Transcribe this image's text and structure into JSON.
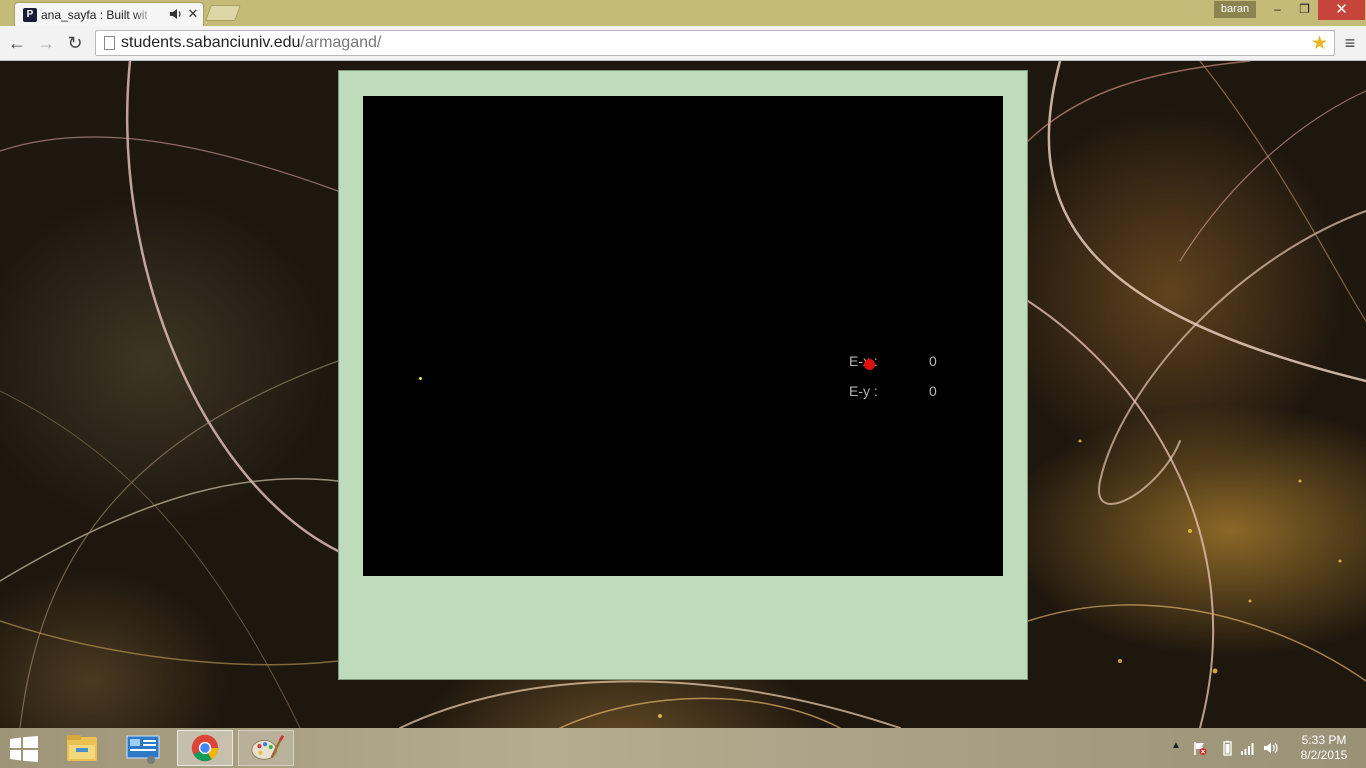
{
  "browser": {
    "tab": {
      "title": "ana_sayfa : Built with P",
      "favicon_letter": "P"
    },
    "profile_name": "baran",
    "window_controls": {
      "minimize": "–",
      "maximize": "❐",
      "close": "✕"
    },
    "toolbar": {
      "back": "←",
      "forward": "→",
      "reload": "↻",
      "menu": "≡"
    },
    "address": {
      "host": "students.sabanciuniv.edu",
      "path": "/armagand/"
    }
  },
  "page": {
    "readouts": [
      {
        "label": "E-x :",
        "value": "0"
      },
      {
        "label": "E-y :",
        "value": "0"
      }
    ],
    "colors": {
      "frame": "#bedbbc",
      "canvas": "#000000",
      "enemy": "#e01010",
      "player": "#f0e040"
    }
  },
  "taskbar": {
    "pinned": [
      "file-explorer-icon",
      "control-panel-icon",
      "chrome-icon",
      "paint-icon"
    ],
    "clock": {
      "time": "5:33 PM",
      "date": "8/2/2015"
    }
  }
}
